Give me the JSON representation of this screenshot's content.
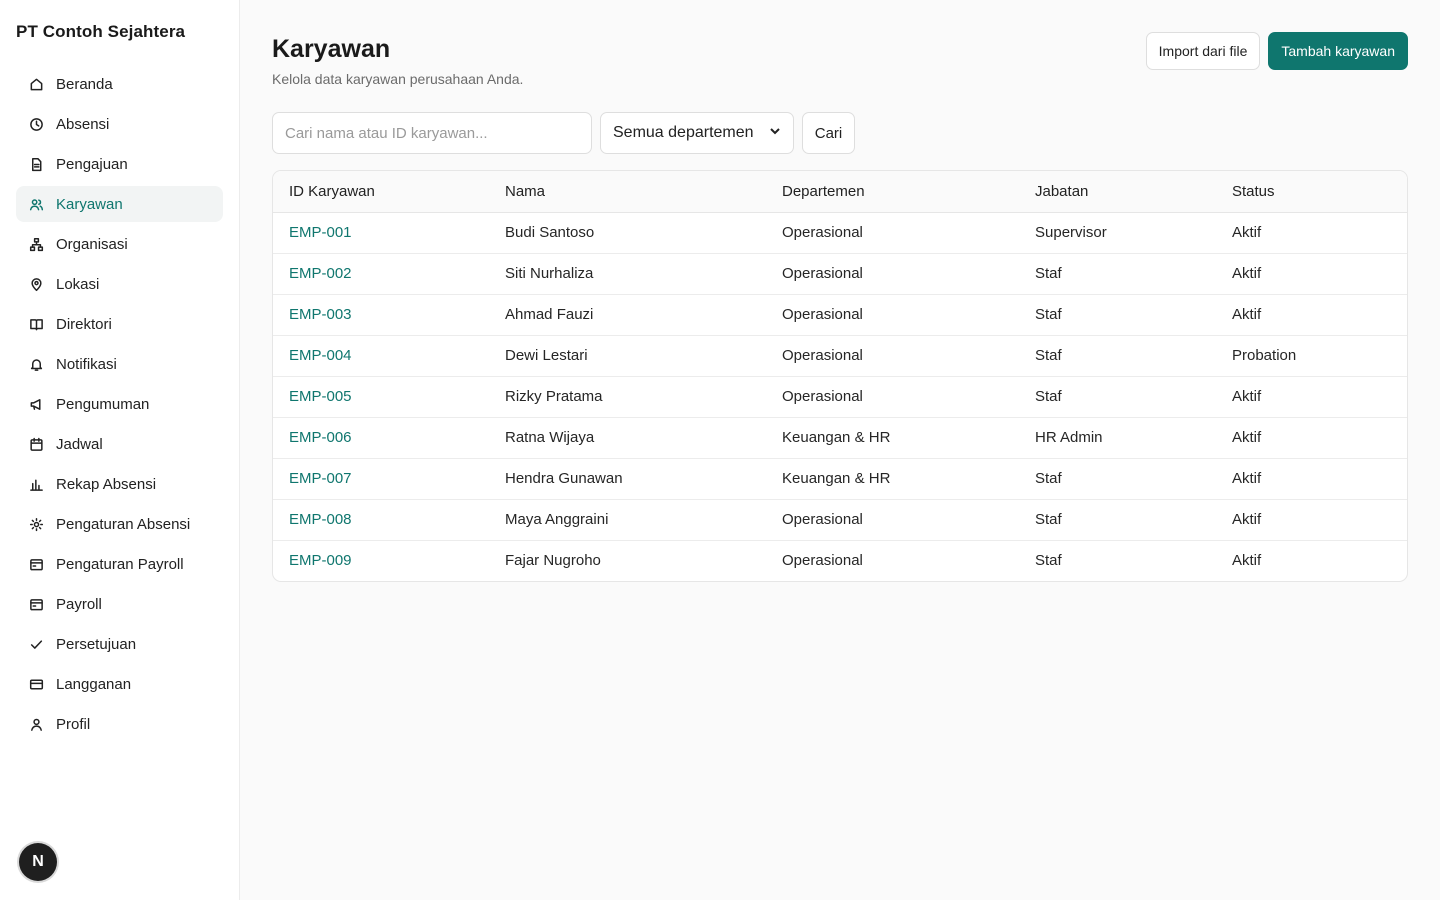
{
  "sidebar": {
    "brand": "PT Contoh Sejahtera",
    "items": [
      {
        "label": "Beranda",
        "icon": "home-icon"
      },
      {
        "label": "Absensi",
        "icon": "clock-icon"
      },
      {
        "label": "Pengajuan",
        "icon": "document-icon"
      },
      {
        "label": "Karyawan",
        "icon": "users-icon",
        "active": true
      },
      {
        "label": "Organisasi",
        "icon": "org-chart-icon"
      },
      {
        "label": "Lokasi",
        "icon": "map-pin-icon"
      },
      {
        "label": "Direktori",
        "icon": "book-icon"
      },
      {
        "label": "Notifikasi",
        "icon": "bell-icon"
      },
      {
        "label": "Pengumuman",
        "icon": "megaphone-icon"
      },
      {
        "label": "Jadwal",
        "icon": "calendar-icon"
      },
      {
        "label": "Rekap Absensi",
        "icon": "bar-chart-icon"
      },
      {
        "label": "Pengaturan Absensi",
        "icon": "gear-icon"
      },
      {
        "label": "Pengaturan Payroll",
        "icon": "wallet-icon"
      },
      {
        "label": "Payroll",
        "icon": "wallet-icon"
      },
      {
        "label": "Persetujuan",
        "icon": "check-icon"
      },
      {
        "label": "Langganan",
        "icon": "credit-card-icon"
      },
      {
        "label": "Profil",
        "icon": "user-icon"
      }
    ],
    "avatar_letter": "N"
  },
  "header": {
    "title": "Karyawan",
    "subtitle": "Kelola data karyawan perusahaan Anda.",
    "import_label": "Import dari file",
    "add_label": "Tambah karyawan"
  },
  "filters": {
    "search_placeholder": "Cari nama atau ID karyawan...",
    "department_value": "Semua departemen",
    "search_button": "Cari"
  },
  "table": {
    "columns": [
      "ID Karyawan",
      "Nama",
      "Departemen",
      "Jabatan",
      "Status"
    ],
    "rows": [
      [
        "EMP-001",
        "Budi Santoso",
        "Operasional",
        "Supervisor",
        "Aktif"
      ],
      [
        "EMP-002",
        "Siti Nurhaliza",
        "Operasional",
        "Staf",
        "Aktif"
      ],
      [
        "EMP-003",
        "Ahmad Fauzi",
        "Operasional",
        "Staf",
        "Aktif"
      ],
      [
        "EMP-004",
        "Dewi Lestari",
        "Operasional",
        "Staf",
        "Probation"
      ],
      [
        "EMP-005",
        "Rizky Pratama",
        "Operasional",
        "Staf",
        "Aktif"
      ],
      [
        "EMP-006",
        "Ratna Wijaya",
        "Keuangan & HR",
        "HR Admin",
        "Aktif"
      ],
      [
        "EMP-007",
        "Hendra Gunawan",
        "Keuangan & HR",
        "Staf",
        "Aktif"
      ],
      [
        "EMP-008",
        "Maya Anggraini",
        "Operasional",
        "Staf",
        "Aktif"
      ],
      [
        "EMP-009",
        "Fajar Nugroho",
        "Operasional",
        "Staf",
        "Aktif"
      ]
    ]
  },
  "colors": {
    "accent": "#0f766e",
    "active_bg": "#f2f4f4"
  }
}
